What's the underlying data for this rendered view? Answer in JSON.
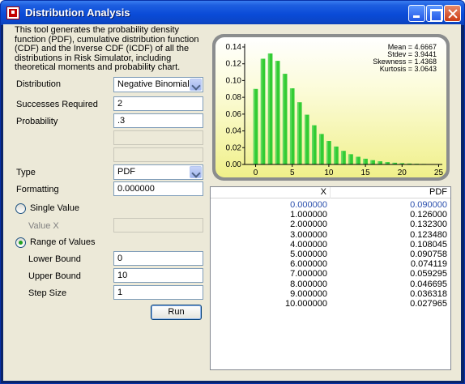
{
  "window": {
    "title": "Distribution Analysis"
  },
  "description": "This tool generates the probability density function (PDF), cumulative distribution function (CDF) and the Inverse CDF (ICDF) of all the distributions in Risk Simulator, including theoretical moments and probability chart.",
  "form": {
    "distribution_label": "Distribution",
    "distribution_value": "Negative Binomial",
    "successes_label": "Successes Required",
    "successes_value": "2",
    "probability_label": "Probability",
    "probability_value": ".3",
    "type_label": "Type",
    "type_value": "PDF",
    "formatting_label": "Formatting",
    "formatting_value": "0.000000",
    "single_value_label": "Single Value",
    "value_x_label": "Value X",
    "range_label": "Range of Values",
    "lower_label": "Lower Bound",
    "lower_value": "0",
    "upper_label": "Upper Bound",
    "upper_value": "10",
    "step_label": "Step Size",
    "step_value": "1",
    "run_label": "Run",
    "mode": "range"
  },
  "stats": {
    "mean": "Mean = 4.6667",
    "stdev": "Stdev = 3.9441",
    "skewness": "Skewness = 1.4368",
    "kurtosis": "Kurtosis = 3.0643"
  },
  "chart_data": {
    "type": "bar",
    "x": [
      0,
      1,
      2,
      3,
      4,
      5,
      6,
      7,
      8,
      9,
      10,
      11,
      12,
      13,
      14,
      15,
      16,
      17,
      18,
      19,
      20,
      21,
      22,
      23,
      24,
      25
    ],
    "values": [
      0.09,
      0.126,
      0.1323,
      0.12348,
      0.108045,
      0.090758,
      0.074119,
      0.059295,
      0.046695,
      0.036318,
      0.027965,
      0.021353,
      0.016193,
      0.012209,
      0.009158,
      0.006839,
      0.005088,
      0.003772,
      0.002787,
      0.002053,
      0.001508,
      0.001105,
      0.000808,
      0.000589,
      0.000429,
      0.000312
    ],
    "xticks": [
      "0",
      "5",
      "10",
      "15",
      "20",
      "25"
    ],
    "yticks": [
      "0.00",
      "0.02",
      "0.04",
      "0.06",
      "0.08",
      "0.10",
      "0.12",
      "0.14"
    ],
    "xlim": [
      -1.5,
      25.5
    ],
    "ylim": [
      0,
      0.14
    ],
    "bar_color": "#33cc33"
  },
  "table": {
    "headers": [
      "X",
      "PDF"
    ],
    "rows": [
      [
        "0.000000",
        "0.090000"
      ],
      [
        "1.000000",
        "0.126000"
      ],
      [
        "2.000000",
        "0.132300"
      ],
      [
        "3.000000",
        "0.123480"
      ],
      [
        "4.000000",
        "0.108045"
      ],
      [
        "5.000000",
        "0.090758"
      ],
      [
        "6.000000",
        "0.074119"
      ],
      [
        "7.000000",
        "0.059295"
      ],
      [
        "8.000000",
        "0.046695"
      ],
      [
        "9.000000",
        "0.036318"
      ],
      [
        "10.000000",
        "0.027965"
      ]
    ]
  }
}
